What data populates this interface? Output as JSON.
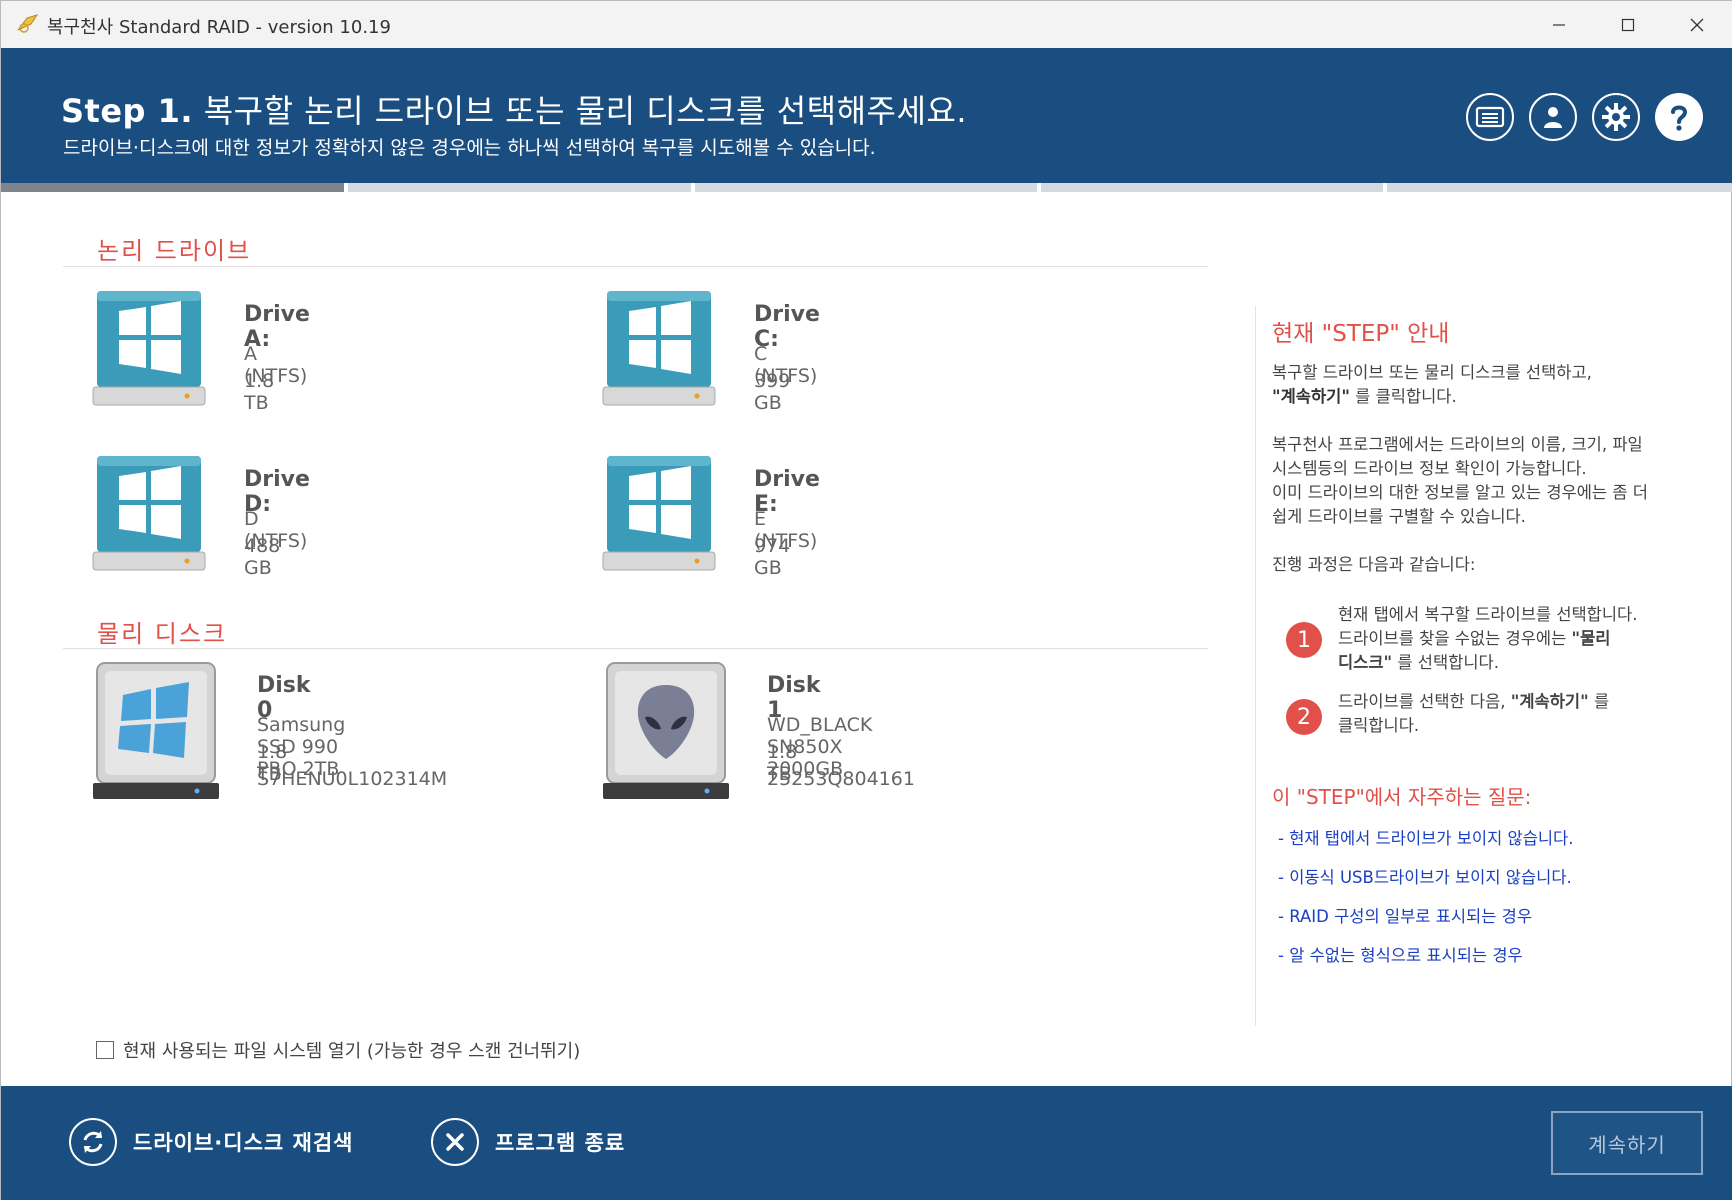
{
  "window": {
    "title": "복구천사 Standard RAID - version 10.19"
  },
  "header": {
    "step_label": "Step 1.",
    "step_title": "복구할 논리 드라이브 또는 물리 디스크를 선택해주세요.",
    "subtitle": "드라이브·디스크에 대한 정보가 정확하지 않은 경우에는 하나씩 선택하여 복구를 시도해볼 수 있습니다."
  },
  "progress": {
    "current_step": 1,
    "total_steps": 5
  },
  "logical": {
    "title": "논리 드라이브",
    "drives": [
      {
        "name": "Drive A:",
        "fs": "A (NTFS)",
        "size": "1.8 TB"
      },
      {
        "name": "Drive C:",
        "fs": "C (NTFS)",
        "size": "399 GB"
      },
      {
        "name": "Drive D:",
        "fs": "D (NTFS)",
        "size": "488 GB"
      },
      {
        "name": "Drive E:",
        "fs": "E (NTFS)",
        "size": "974 GB"
      }
    ]
  },
  "physical": {
    "title": "물리 디스크",
    "disks": [
      {
        "name": "Disk 0",
        "model": "Samsung SSD 990 PRO 2TB",
        "size": "1.8 TB",
        "serial": "S7HENU0L102314M"
      },
      {
        "name": "Disk 1",
        "model": "WD_BLACK SN850X 2000GB",
        "size": "1.8 TB",
        "serial": "25253Q804161"
      }
    ]
  },
  "checkbox": {
    "label": "현재 사용되는 파일 시스템 열기 (가능한 경우 스캔 건너뛰기)",
    "checked": false
  },
  "side": {
    "title": "현재 \"STEP\" 안내",
    "intro_1": "복구할 드라이브 또는 물리 디스크를 선택하고,",
    "intro_2_bold": "\"계속하기\"",
    "intro_2_rest": " 를 클릭합니다.",
    "para_1": "복구천사 프로그램에서는 드라이브의 이름, 크기, 파일",
    "para_2": "시스템등의 드라이브 정보 확인이 가능합니다.",
    "para_3": "이미 드라이브의 대한 정보를 알고 있는 경우에는 좀 더",
    "para_4": "쉽게 드라이브를 구별할 수 있습니다.",
    "process": "진행 과정은 다음과 같습니다:",
    "step1_num": "1",
    "step1_a": "현재 탭에서 복구할 드라이브를 선택합니다.",
    "step1_b": "드라이브를 찾을 수없는 경우에는 ",
    "step1_b_bold": "\"물리",
    "step1_c_bold": "디스크\"",
    "step1_c": " 를 선택합니다.",
    "step2_num": "2",
    "step2_a": "드라이브를 선택한 다음, ",
    "step2_a_bold": "\"계속하기\"",
    "step2_a_rest": " 를",
    "step2_b": "클릭합니다.",
    "faq_title": "이 \"STEP\"에서 자주하는 질문:",
    "faqs": [
      "- 현재 탭에서 드라이브가 보이지 않습니다.",
      "- 이동식 USB드라이브가 보이지 않습니다.",
      "- RAID 구성의 일부로 표시되는 경우",
      "- 알 수없는 형식으로 표시되는 경우"
    ]
  },
  "footer": {
    "rescan_label": "드라이브·디스크 재검색",
    "exit_label": "프로그램 종료",
    "continue_label": "계속하기"
  },
  "colors": {
    "header_bg": "#1a4d80",
    "accent_red": "#e2504a",
    "link_blue": "#1a3fc0",
    "drive_teal": "#3a9cb8"
  }
}
